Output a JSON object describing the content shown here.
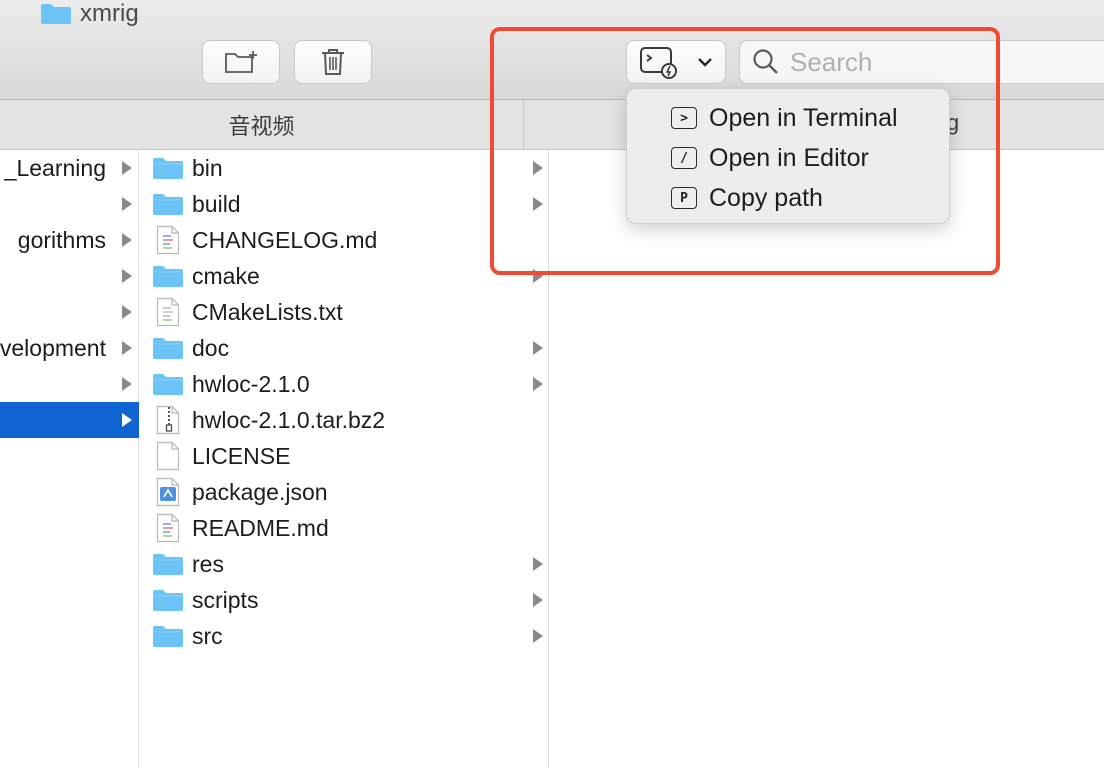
{
  "window": {
    "title": "xmrig"
  },
  "toolbar": {
    "search_placeholder": "Search"
  },
  "column_headers": [
    "音视频",
    "ig"
  ],
  "parent_column": {
    "items": [
      {
        "label": "_Learning",
        "has_children": true,
        "selected": false
      },
      {
        "label": "",
        "has_children": true,
        "selected": false
      },
      {
        "label": "gorithms",
        "has_children": true,
        "selected": false
      },
      {
        "label": "",
        "has_children": true,
        "selected": false
      },
      {
        "label": "",
        "has_children": true,
        "selected": false
      },
      {
        "label": "velopment",
        "has_children": true,
        "selected": false
      },
      {
        "label": "",
        "has_children": true,
        "selected": false
      },
      {
        "label": "",
        "has_children": true,
        "selected": true
      }
    ]
  },
  "files": [
    {
      "name": "bin",
      "type": "folder",
      "has_children": true
    },
    {
      "name": "build",
      "type": "folder",
      "has_children": true
    },
    {
      "name": "CHANGELOG.md",
      "type": "markdown",
      "has_children": false
    },
    {
      "name": "cmake",
      "type": "folder",
      "has_children": true
    },
    {
      "name": "CMakeLists.txt",
      "type": "text",
      "has_children": false
    },
    {
      "name": "doc",
      "type": "folder",
      "has_children": true
    },
    {
      "name": "hwloc-2.1.0",
      "type": "folder",
      "has_children": true
    },
    {
      "name": "hwloc-2.1.0.tar.bz2",
      "type": "archive",
      "has_children": false
    },
    {
      "name": "LICENSE",
      "type": "blank",
      "has_children": false
    },
    {
      "name": "package.json",
      "type": "json",
      "has_children": false
    },
    {
      "name": "README.md",
      "type": "markdown",
      "has_children": false
    },
    {
      "name": "res",
      "type": "folder",
      "has_children": true
    },
    {
      "name": "scripts",
      "type": "folder",
      "has_children": true
    },
    {
      "name": "src",
      "type": "folder",
      "has_children": true
    }
  ],
  "menu": {
    "items": [
      {
        "label": "Open in Terminal",
        "icon": "terminal-icon",
        "glyph": ">"
      },
      {
        "label": "Open in Editor",
        "icon": "editor-icon",
        "glyph": "/"
      },
      {
        "label": "Copy path",
        "icon": "copy-path-icon",
        "glyph": "P"
      }
    ]
  },
  "colors": {
    "selection": "#0f64d2",
    "folder": "#6cc3f5",
    "highlight": "#ef4b34"
  }
}
